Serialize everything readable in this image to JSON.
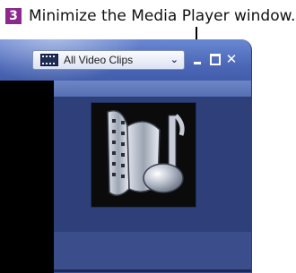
{
  "caption": {
    "step": "3",
    "text": "Minimize the Media Player window."
  },
  "toolbar": {
    "library_label": "All Video Clips",
    "library_icon": "video-clips-icon"
  },
  "window_controls": {
    "minimize_icon": "minimize-icon",
    "maximize_icon": "maximize-icon",
    "close_glyph": "✕"
  },
  "colors": {
    "badge": "#8b2a8c",
    "title_bar": "#4a66b6",
    "content_bg": "#3b4e8b"
  },
  "artwork": "film-reel-music-note-icon"
}
